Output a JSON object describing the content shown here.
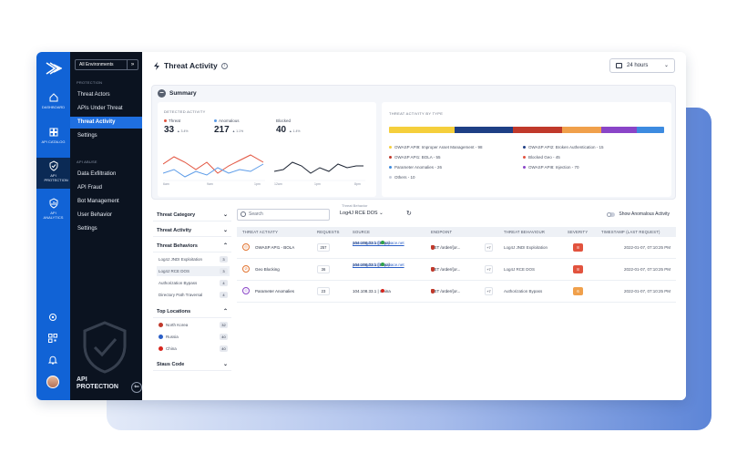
{
  "colors": {
    "rail": "#1163d6",
    "nav": "#0b1320",
    "nav_active": "#1f6fe0",
    "threat_line": "#e2533e",
    "anomalous_line": "#5b9be8",
    "blocked_line": "#1c2433",
    "severity_high": "#e2533e",
    "severity_medium": "#f0a04b"
  },
  "rail": {
    "items": [
      {
        "label": "DASHBOARD",
        "icon": "home-icon"
      },
      {
        "label": "API CATALOG",
        "icon": "grid-icon"
      },
      {
        "label": "API PROTECTION",
        "icon": "shield-icon"
      },
      {
        "label": "API ANALYTICS",
        "icon": "analytics-icon"
      }
    ],
    "bottom_icons": [
      "settings-icon",
      "qr-icon",
      "bell-icon",
      "user-avatar"
    ]
  },
  "nav": {
    "env_select": "All Environments",
    "section_protection": "PROTECTION",
    "protection_items": [
      "Threat Actors",
      "APIs Under Threat",
      "Threat Activity",
      "Settings"
    ],
    "section_abuse": "API ABUSE",
    "abuse_items": [
      "Data Exfiltration",
      "API Fraud",
      "Bot Management",
      "User Behavior",
      "Settings"
    ],
    "footer_line1": "API",
    "footer_line2": "PROTECTION",
    "collapse": "⇐"
  },
  "header": {
    "title": "Threat Activity",
    "info": "i",
    "time_range": "24 hours",
    "chevron": "⌄"
  },
  "summary": {
    "title": "Summary",
    "toggle": "−",
    "detected_label": "DETECTED ACTIVITY",
    "threat_label": "Threat",
    "threat_value": "33",
    "threat_change": "▲ 3.4%",
    "anomalous_label": "Anomalous",
    "anomalous_value": "217",
    "anomalous_change": "▲ 1.1%",
    "blocked_label": "Blocked",
    "blocked_value": "40",
    "blocked_change": "▲ 1.4%",
    "chart_ticks_left": [
      "6am",
      "9am",
      "1pm"
    ],
    "chart_ticks_right": [
      "12am",
      "1pm",
      "8pm"
    ],
    "type_label": "THREAT ACTIVITY BY TYPE",
    "type_bar": [
      {
        "color": "#f5cf3c",
        "share": 0.24
      },
      {
        "color": "#1e3f85",
        "share": 0.21
      },
      {
        "color": "#c0392b",
        "share": 0.18
      },
      {
        "color": "#f0a04b",
        "share": 0.14
      },
      {
        "color": "#8a45c8",
        "share": 0.13
      },
      {
        "color": "#3d8be0",
        "share": 0.1
      }
    ],
    "legend": [
      {
        "text": "OWASP API9: Improper Asset Management - 98",
        "color": "#f5cf3c"
      },
      {
        "text": "OWASP API2: Broken Authentication - 15",
        "color": "#1e3f85"
      },
      {
        "text": "OWASP API1: BOLA - 55",
        "color": "#c0392b"
      },
      {
        "text": "Blocked Geo - 45",
        "color": "#e2533e"
      },
      {
        "text": "Parameter Anomalies - 26",
        "color": "#3d8be0"
      },
      {
        "text": "OWASP API8: Injection - 70",
        "color": "#8a45c8"
      },
      {
        "text": "Others - 10",
        "color": "#c9ceda"
      }
    ]
  },
  "filters": {
    "threat_category": "Threat Category",
    "threat_activity": "Threat Activity",
    "threat_behaviors": "Threat Behaviors",
    "behaviors": [
      {
        "label": "Log4J JNDI Exploitation",
        "count": "3"
      },
      {
        "label": "Log4J RCE DOS",
        "count": "3"
      },
      {
        "label": "Authorization Bypass",
        "count": "4"
      },
      {
        "label": "Directory Path Traversal",
        "count": "4"
      }
    ],
    "top_locations": "Top Locations",
    "locations": [
      {
        "label": "North Korea",
        "count": "32",
        "flag": "#c0392b"
      },
      {
        "label": "Russia",
        "count": "40",
        "flag": "#2b5fc7"
      },
      {
        "label": "China",
        "count": "40",
        "flag": "#d7261e"
      }
    ],
    "status_code": "Staus Code",
    "chev_down": "⌄",
    "chev_up": "⌃"
  },
  "toolbar": {
    "search_placeholder": "Search",
    "tb_label": "Threat Behavior",
    "tb_value": "Log4J RCE DOS ⌄",
    "refresh": "↻",
    "anomalous_toggle": "Show Anomalous Activity"
  },
  "table": {
    "headers": [
      "THREAT ACTIVITY",
      "REQUESTS",
      "SOURCE",
      "ENDPOINT",
      "THREAT BEHAVIOUR",
      "SEVERITY",
      "TIMESTAMP (LAST REQUEST)"
    ],
    "rows": [
      {
        "activity": "OWASP API1 - BOLA",
        "requests": "257",
        "email": "passengduck@myspace.net",
        "ip": "104.108.33.1 | ",
        "country": "Brazil",
        "endpoint": "GET /order/{or...",
        "more": "+7",
        "behavior": "Log4J JNDI Exploitation",
        "severity": "8",
        "sev_color": "#e2533e",
        "timestamp": "2022-01-07, 07:10:25 PM"
      },
      {
        "activity": "Geo Blocking",
        "requests": "36",
        "email": "passengduck@myspace.net",
        "ip": "104.108.33.1 | ",
        "country": "Brazil",
        "endpoint": "GET /order/{or...",
        "more": "+7",
        "behavior": "Log4J RCE DOS",
        "severity": "8",
        "sev_color": "#e2533e",
        "timestamp": "2022-01-07, 07:10:25 PM"
      },
      {
        "activity": "Parameter Anomalies",
        "requests": "23",
        "email": "",
        "ip": "104.108.33.1 | ",
        "country": "China",
        "endpoint": "GET /order/{or...",
        "more": "+7",
        "behavior": "Authorization Bypass",
        "severity": "6",
        "sev_color": "#f0a04b",
        "timestamp": "2022-01-07, 07:10:25 PM"
      }
    ]
  }
}
